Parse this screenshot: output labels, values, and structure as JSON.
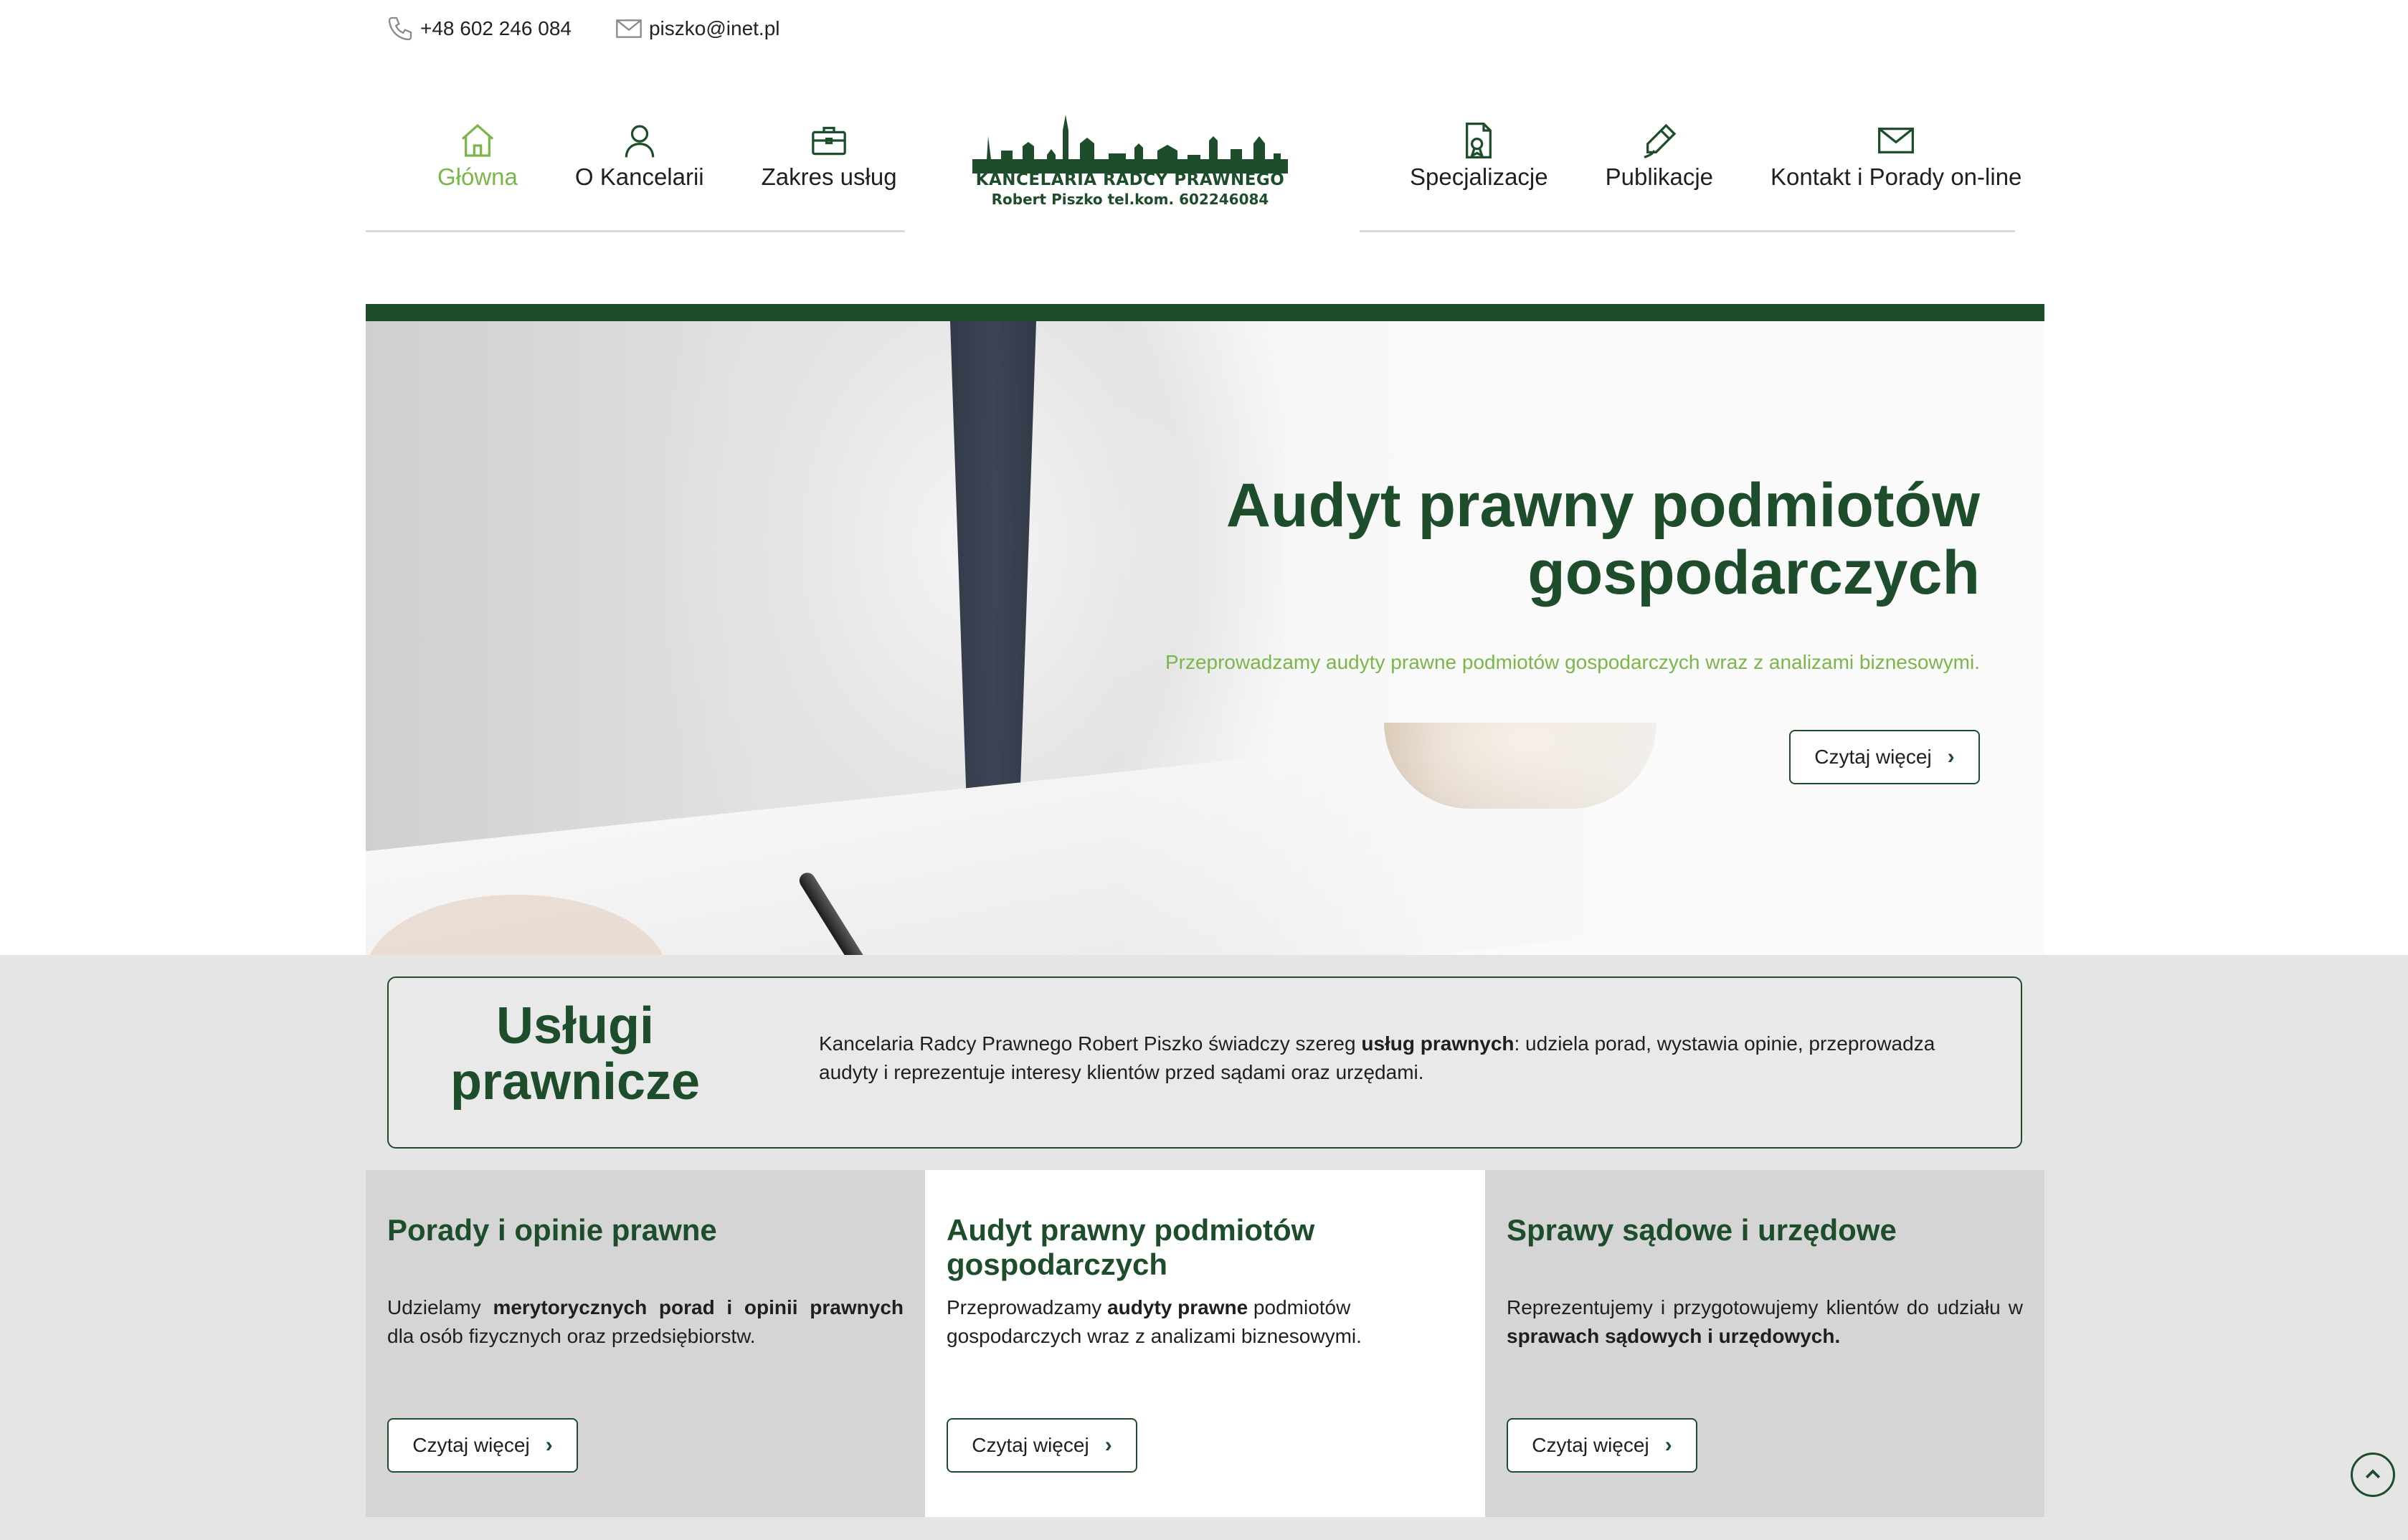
{
  "contact": {
    "phone": "+48 602 246 084",
    "email": "piszko@inet.pl",
    "phone_icon": "phone-icon",
    "email_icon": "envelope-icon"
  },
  "nav": {
    "left": [
      {
        "label": "Główna",
        "icon": "home-icon",
        "active": true
      },
      {
        "label": "O Kancelarii",
        "icon": "user-icon",
        "active": false
      },
      {
        "label": "Zakres usług",
        "icon": "briefcase-icon",
        "active": false
      }
    ],
    "right": [
      {
        "label": "Specjalizacje",
        "icon": "document-icon"
      },
      {
        "label": "Publikacje",
        "icon": "pen-icon"
      },
      {
        "label": "Kontakt i Porady on-line",
        "icon": "envelope-icon"
      }
    ]
  },
  "logo": {
    "line1": "KANCELARIA RADCY PRAWNEGO",
    "line2": "Robert Piszko  tel.kom. 602246084"
  },
  "hero": {
    "title": "Audyt prawny podmiotów gospodarczych",
    "subtitle": "Przeprowadzamy audyty prawne podmiotów gospodarczych wraz z analizami biznesowymi.",
    "button": "Czytaj więcej"
  },
  "services": {
    "title": "Usługi prawnicze",
    "text_before": "Kancelaria Radcy Prawnego Robert Piszko świadczy szereg ",
    "text_bold": "usług prawnych",
    "text_after": ": udziela porad, wystawia opinie, przeprowadza audyty i reprezentuje interesy klientów przed sądami oraz urzędami."
  },
  "cards": [
    {
      "title": "Porady i opinie prawne",
      "text_before": "Udzielamy ",
      "text_bold": "merytorycznych porad i opinii prawnych",
      "text_after": " dla osób fizycznych oraz przedsiębiorstw.",
      "button": "Czytaj więcej"
    },
    {
      "title": "Audyt prawny podmiotów gospodarczych",
      "text_before": "Przeprowadzamy ",
      "text_bold": "audyty prawne",
      "text_after": " podmiotów gospodarczych wraz z analizami biznesowymi.",
      "button": "Czytaj więcej"
    },
    {
      "title": "Sprawy sądowe i urzędowe",
      "text_before": "Reprezentujemy i przygotowujemy klientów do udziału w ",
      "text_bold": "sprawach sądowych i urzędowych.",
      "text_after": "",
      "button": "Czytaj więcej"
    }
  ],
  "colors": {
    "brand_green": "#1e4d2b",
    "accent_green": "#7ab648",
    "section_grey": "#e5e5e5",
    "card_grey": "#d5d5d5"
  }
}
